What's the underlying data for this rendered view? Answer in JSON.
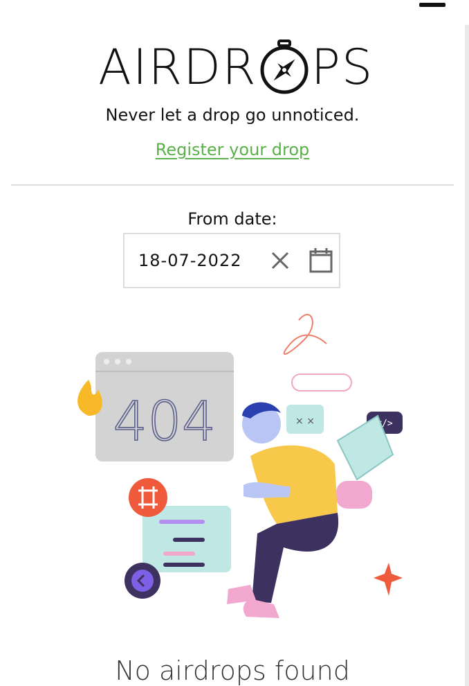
{
  "header": {
    "menu_icon": "hamburger-menu-icon",
    "logo_left": "AIRDR",
    "logo_right": "PS",
    "logo_icon": "compass-icon",
    "tagline": "Never let a drop go unnoticed.",
    "register_link": "Register your drop"
  },
  "filter": {
    "label": "From date:",
    "date_value": "18-07-2022",
    "clear_icon": "close-icon",
    "calendar_icon": "calendar-icon"
  },
  "empty_state": {
    "illustration_text": "404",
    "message": "No airdrops found"
  },
  "colors": {
    "link": "#5ab04a",
    "text": "#111111",
    "divider": "#dedede"
  }
}
